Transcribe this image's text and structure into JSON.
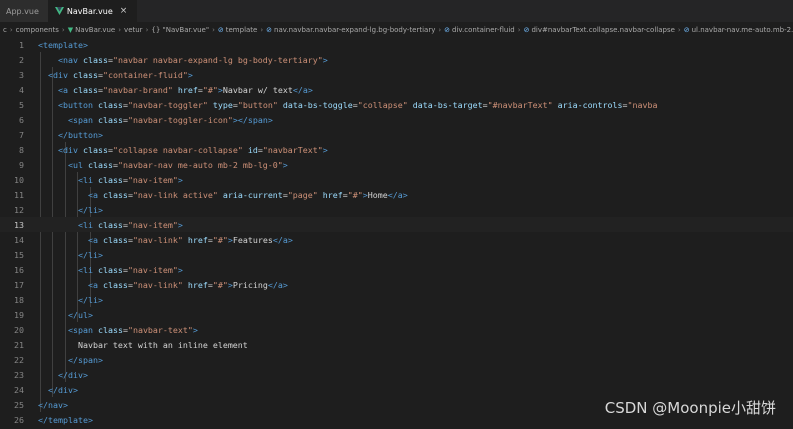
{
  "tabs": [
    {
      "label": "App.vue",
      "active": false
    },
    {
      "label": "NavBar.vue",
      "active": true,
      "close_glyph": "×"
    }
  ],
  "breadcrumb": [
    "components",
    "NavBar.vue",
    "vetur",
    "{} \"NavBar.vue\"",
    "template",
    "nav.navbar.navbar-expand-lg.bg-body-tertiary",
    "div.container-fluid",
    "div#navbarText.collapse.navbar-collapse",
    "ul.navbar-nav.me-auto.mb-2.mb-lg-0"
  ],
  "breadcrumb_leading": "c",
  "editor": {
    "current_line": 13,
    "lines": [
      {
        "n": "1",
        "tokens": [
          [
            "tag",
            "<template>"
          ]
        ]
      },
      {
        "n": "2",
        "tokens": [
          [
            "txt",
            "    "
          ],
          [
            "tag",
            "<nav "
          ],
          [
            "attr",
            "class"
          ],
          [
            "txt",
            "="
          ],
          [
            "str",
            "\"navbar navbar-expand-lg bg-body-tertiary\""
          ],
          [
            "tag",
            ">"
          ]
        ]
      },
      {
        "n": "3",
        "tokens": [
          [
            "txt",
            "  "
          ],
          [
            "tag",
            "<div "
          ],
          [
            "attr",
            "class"
          ],
          [
            "txt",
            "="
          ],
          [
            "str",
            "\"container-fluid\""
          ],
          [
            "tag",
            ">"
          ]
        ]
      },
      {
        "n": "4",
        "tokens": [
          [
            "txt",
            "    "
          ],
          [
            "tag",
            "<a "
          ],
          [
            "attr",
            "class"
          ],
          [
            "txt",
            "="
          ],
          [
            "str",
            "\"navbar-brand\""
          ],
          [
            "txt",
            " "
          ],
          [
            "attr",
            "href"
          ],
          [
            "txt",
            "="
          ],
          [
            "str",
            "\"#\""
          ],
          [
            "tag",
            ">"
          ],
          [
            "txt",
            "Navbar w/ text"
          ],
          [
            "tag",
            "</a>"
          ]
        ]
      },
      {
        "n": "5",
        "tokens": [
          [
            "txt",
            "    "
          ],
          [
            "tag",
            "<button "
          ],
          [
            "attr",
            "class"
          ],
          [
            "txt",
            "="
          ],
          [
            "str",
            "\"navbar-toggler\""
          ],
          [
            "txt",
            " "
          ],
          [
            "attr",
            "type"
          ],
          [
            "txt",
            "="
          ],
          [
            "str",
            "\"button\""
          ],
          [
            "txt",
            " "
          ],
          [
            "attr",
            "data-bs-toggle"
          ],
          [
            "txt",
            "="
          ],
          [
            "str",
            "\"collapse\""
          ],
          [
            "txt",
            " "
          ],
          [
            "attr",
            "data-bs-target"
          ],
          [
            "txt",
            "="
          ],
          [
            "str",
            "\"#navbarText\""
          ],
          [
            "txt",
            " "
          ],
          [
            "attr",
            "aria-controls"
          ],
          [
            "txt",
            "="
          ],
          [
            "str",
            "\"navba"
          ]
        ]
      },
      {
        "n": "6",
        "tokens": [
          [
            "txt",
            "      "
          ],
          [
            "tag",
            "<span "
          ],
          [
            "attr",
            "class"
          ],
          [
            "txt",
            "="
          ],
          [
            "str",
            "\"navbar-toggler-icon\""
          ],
          [
            "tag",
            "></span>"
          ]
        ]
      },
      {
        "n": "7",
        "tokens": [
          [
            "txt",
            "    "
          ],
          [
            "tag",
            "</button>"
          ]
        ]
      },
      {
        "n": "8",
        "tokens": [
          [
            "txt",
            "    "
          ],
          [
            "tag",
            "<div "
          ],
          [
            "attr",
            "class"
          ],
          [
            "txt",
            "="
          ],
          [
            "str",
            "\"collapse navbar-collapse\""
          ],
          [
            "txt",
            " "
          ],
          [
            "attr",
            "id"
          ],
          [
            "txt",
            "="
          ],
          [
            "str",
            "\"navbarText\""
          ],
          [
            "tag",
            ">"
          ]
        ]
      },
      {
        "n": "9",
        "tokens": [
          [
            "txt",
            "      "
          ],
          [
            "tag",
            "<ul "
          ],
          [
            "attr",
            "class"
          ],
          [
            "txt",
            "="
          ],
          [
            "str",
            "\"navbar-nav me-auto mb-2 mb-lg-0\""
          ],
          [
            "tag",
            ">"
          ]
        ]
      },
      {
        "n": "10",
        "tokens": [
          [
            "txt",
            "        "
          ],
          [
            "tag",
            "<li "
          ],
          [
            "attr",
            "class"
          ],
          [
            "txt",
            "="
          ],
          [
            "str",
            "\"nav-item\""
          ],
          [
            "tag",
            ">"
          ]
        ]
      },
      {
        "n": "11",
        "tokens": [
          [
            "txt",
            "          "
          ],
          [
            "tag",
            "<a "
          ],
          [
            "attr",
            "class"
          ],
          [
            "txt",
            "="
          ],
          [
            "str",
            "\"nav-link active\""
          ],
          [
            "txt",
            " "
          ],
          [
            "attr",
            "aria-current"
          ],
          [
            "txt",
            "="
          ],
          [
            "str",
            "\"page\""
          ],
          [
            "txt",
            " "
          ],
          [
            "attr",
            "href"
          ],
          [
            "txt",
            "="
          ],
          [
            "str",
            "\"#\""
          ],
          [
            "tag",
            ">"
          ],
          [
            "txt",
            "Home"
          ],
          [
            "tag",
            "</a>"
          ]
        ]
      },
      {
        "n": "12",
        "tokens": [
          [
            "txt",
            "        "
          ],
          [
            "tag",
            "</li>"
          ]
        ]
      },
      {
        "n": "13",
        "tokens": [
          [
            "txt",
            "        "
          ],
          [
            "tag",
            "<li "
          ],
          [
            "attr",
            "class"
          ],
          [
            "txt",
            "="
          ],
          [
            "str",
            "\"nav-item\""
          ],
          [
            "tag",
            ">"
          ]
        ]
      },
      {
        "n": "14",
        "tokens": [
          [
            "txt",
            "          "
          ],
          [
            "tag",
            "<a "
          ],
          [
            "attr",
            "class"
          ],
          [
            "txt",
            "="
          ],
          [
            "str",
            "\"nav-link\""
          ],
          [
            "txt",
            " "
          ],
          [
            "attr",
            "href"
          ],
          [
            "txt",
            "="
          ],
          [
            "str",
            "\"#\""
          ],
          [
            "tag",
            ">"
          ],
          [
            "txt",
            "Features"
          ],
          [
            "tag",
            "</a>"
          ]
        ]
      },
      {
        "n": "15",
        "tokens": [
          [
            "txt",
            "        "
          ],
          [
            "tag",
            "</li>"
          ]
        ]
      },
      {
        "n": "16",
        "tokens": [
          [
            "txt",
            "        "
          ],
          [
            "tag",
            "<li "
          ],
          [
            "attr",
            "class"
          ],
          [
            "txt",
            "="
          ],
          [
            "str",
            "\"nav-item\""
          ],
          [
            "tag",
            ">"
          ]
        ]
      },
      {
        "n": "17",
        "tokens": [
          [
            "txt",
            "          "
          ],
          [
            "tag",
            "<a "
          ],
          [
            "attr",
            "class"
          ],
          [
            "txt",
            "="
          ],
          [
            "str",
            "\"nav-link\""
          ],
          [
            "txt",
            " "
          ],
          [
            "attr",
            "href"
          ],
          [
            "txt",
            "="
          ],
          [
            "str",
            "\"#\""
          ],
          [
            "tag",
            ">"
          ],
          [
            "txt",
            "Pricing"
          ],
          [
            "tag",
            "</a>"
          ]
        ]
      },
      {
        "n": "18",
        "tokens": [
          [
            "txt",
            "        "
          ],
          [
            "tag",
            "</li>"
          ]
        ]
      },
      {
        "n": "19",
        "tokens": [
          [
            "txt",
            "      "
          ],
          [
            "tag",
            "</ul>"
          ]
        ]
      },
      {
        "n": "20",
        "tokens": [
          [
            "txt",
            "      "
          ],
          [
            "tag",
            "<span "
          ],
          [
            "attr",
            "class"
          ],
          [
            "txt",
            "="
          ],
          [
            "str",
            "\"navbar-text\""
          ],
          [
            "tag",
            ">"
          ]
        ]
      },
      {
        "n": "21",
        "tokens": [
          [
            "txt",
            "        Navbar text with an inline element"
          ]
        ]
      },
      {
        "n": "22",
        "tokens": [
          [
            "txt",
            "      "
          ],
          [
            "tag",
            "</span>"
          ]
        ]
      },
      {
        "n": "23",
        "tokens": [
          [
            "txt",
            "    "
          ],
          [
            "tag",
            "</div>"
          ]
        ]
      },
      {
        "n": "24",
        "tokens": [
          [
            "txt",
            "  "
          ],
          [
            "tag",
            "</div>"
          ]
        ]
      },
      {
        "n": "25",
        "tokens": [
          [
            "tag",
            "</nav>"
          ]
        ]
      },
      {
        "n": "26",
        "tokens": [
          [
            "tag",
            "</template>"
          ]
        ]
      }
    ]
  },
  "watermark": "CSDN @Moonpie小甜饼",
  "colors": {
    "background": "#1e1e1e",
    "tag": "#569cd6",
    "attribute": "#9cdcfe",
    "string": "#ce9178",
    "text": "#d4d4d4",
    "line_number": "#858585",
    "vue_green": "#42b883"
  }
}
